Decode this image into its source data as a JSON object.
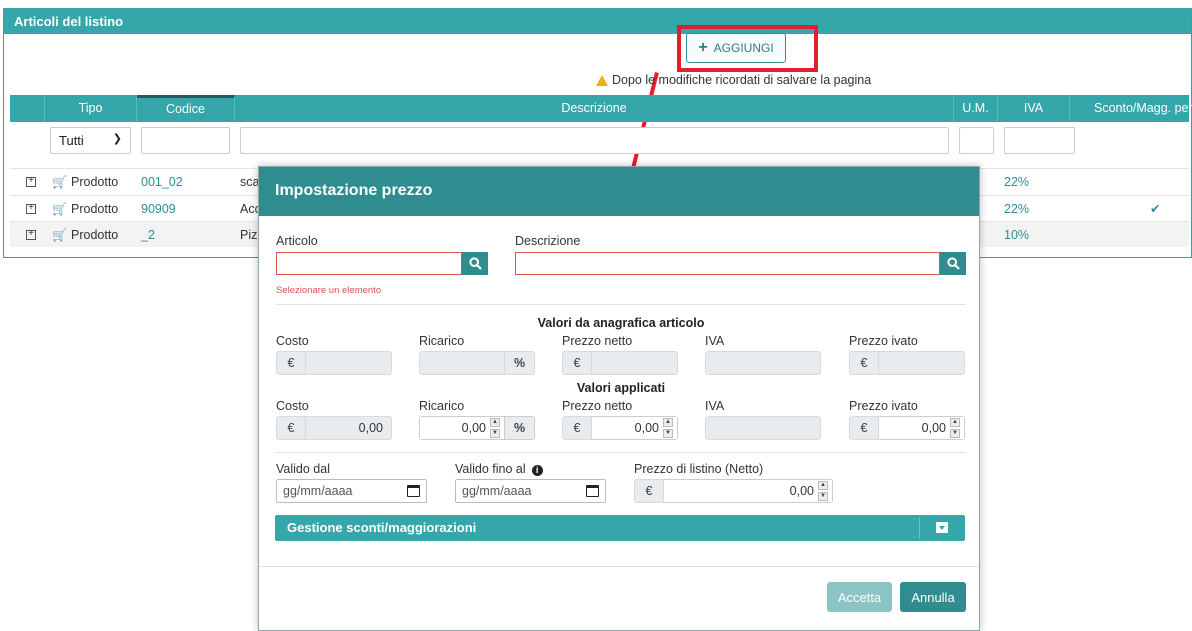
{
  "panel": {
    "title": "Articoli del listino"
  },
  "toolbar": {
    "add_label": "AGGIUNGI",
    "notice": "Dopo le modifiche ricordati di salvare la pagina"
  },
  "grid": {
    "headers": {
      "tipo": "Tipo",
      "codice": "Codice",
      "descrizione": "Descrizione",
      "um": "U.M.",
      "iva": "IVA",
      "sconto": "Sconto/Magg. per"
    },
    "filter_tipo": "Tutti",
    "rows": [
      {
        "tipo": "Prodotto",
        "codice": "001_02",
        "descr": "sca",
        "iva": "22%",
        "check": ""
      },
      {
        "tipo": "Prodotto",
        "codice": "90909",
        "descr": "Acc",
        "iva": "22%",
        "check": "✔"
      },
      {
        "tipo": "Prodotto",
        "codice": "_2",
        "descr": "Pizz",
        "iva": "10%",
        "check": ""
      }
    ]
  },
  "modal": {
    "title": "Impostazione prezzo",
    "articolo_label": "Articolo",
    "descrizione_label": "Descrizione",
    "error": "Selezionare un elemento",
    "anagrafica_title": "Valori da anagrafica articolo",
    "applicati_title": "Valori applicati",
    "labels": {
      "costo": "Costo",
      "ricarico": "Ricarico",
      "prezzo_netto": "Prezzo netto",
      "iva": "IVA",
      "prezzo_ivato": "Prezzo ivato"
    },
    "currency": "€",
    "percent": "%",
    "applied": {
      "costo": "0,00",
      "ricarico": "0,00",
      "prezzo_netto": "0,00",
      "prezzo_ivato": "0,00"
    },
    "valido_dal_label": "Valido dal",
    "valido_fino_label": "Valido fino al",
    "prezzo_listino_label": "Prezzo di listino (Netto)",
    "date_placeholder": "gg/mm/aaaa",
    "prezzo_listino_value": "0,00",
    "accordion_title": "Gestione sconti/maggiorazioni",
    "accept_label": "Accetta",
    "cancel_label": "Annulla"
  }
}
